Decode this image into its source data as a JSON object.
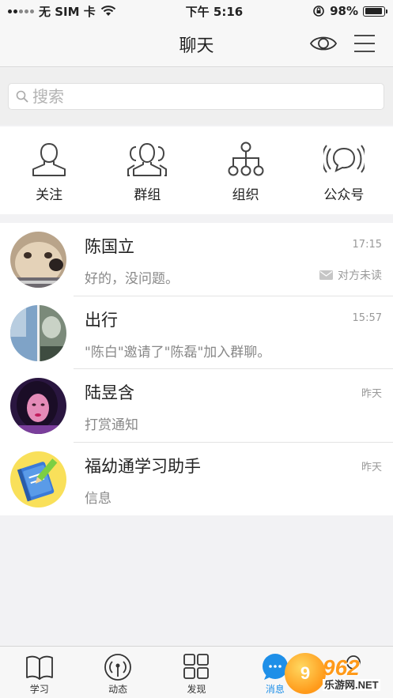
{
  "status_bar": {
    "carrier": "无 SIM 卡",
    "time": "下午 5:16",
    "battery": "98%"
  },
  "nav": {
    "title": "聊天",
    "eye_icon": "eye-icon",
    "menu_icon": "hamburger-menu-icon"
  },
  "search": {
    "placeholder": "搜索"
  },
  "shortcuts": [
    {
      "label": "关注",
      "icon": "person-icon"
    },
    {
      "label": "群组",
      "icon": "group-icon"
    },
    {
      "label": "组织",
      "icon": "org-tree-icon"
    },
    {
      "label": "公众号",
      "icon": "broadcast-icon"
    }
  ],
  "chats": [
    {
      "name": "陈国立",
      "preview": "好的，没问题。",
      "time": "17:15",
      "unread_label": "对方未读",
      "avatar": "dog-avatar"
    },
    {
      "name": "出行",
      "preview": "\"陈白\"邀请了\"陈磊\"加入群聊。",
      "time": "15:57",
      "avatar": "group-photo-avatar"
    },
    {
      "name": "陆昱含",
      "preview": "打赏通知",
      "time": "昨天",
      "avatar": "portrait-avatar"
    },
    {
      "name": "福幼通学习助手",
      "preview": "信息",
      "time": "昨天",
      "avatar": "notebook-avatar"
    }
  ],
  "tabs": [
    {
      "label": "学习",
      "icon": "book-icon"
    },
    {
      "label": "动态",
      "icon": "broadcast-tower-icon"
    },
    {
      "label": "发现",
      "icon": "grid-icon"
    },
    {
      "label": "消息",
      "icon": "chat-bubble-icon",
      "active": true
    },
    {
      "label": "",
      "icon": "profile-icon"
    }
  ],
  "watermark": {
    "number": "962",
    "site": ".NET",
    "brand": "乐游网"
  },
  "colors": {
    "accent": "#1e8fe8",
    "background": "#f2f2f4"
  }
}
